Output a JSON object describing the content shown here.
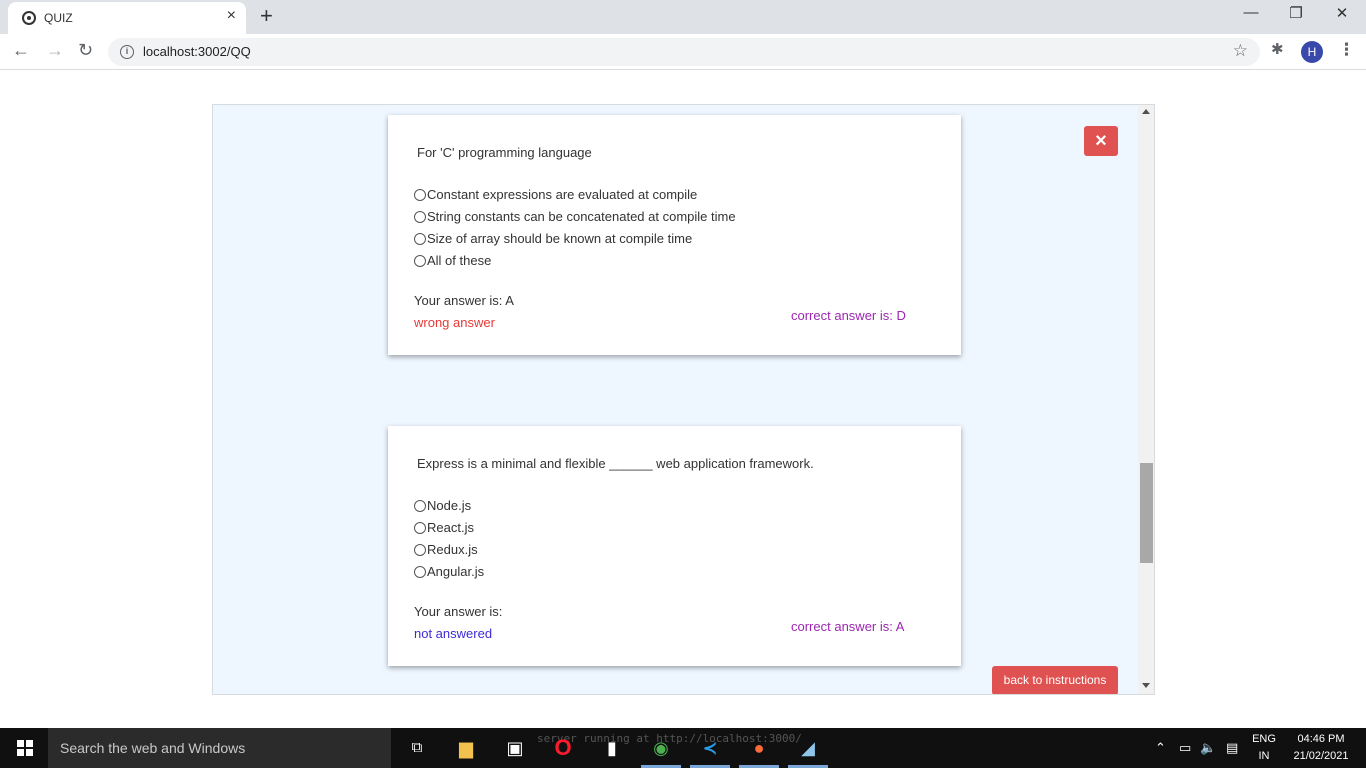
{
  "browser": {
    "tab_title": "QUIZ",
    "tab_close": "×",
    "new_tab": "+",
    "url": "localhost:3002/QQ",
    "avatar_letter": "H",
    "window": {
      "minimize": "—",
      "restore": "❐",
      "close": "✕"
    }
  },
  "quiz": {
    "close_label": "×",
    "back_label": "back to instructions",
    "questions": [
      {
        "text": "For 'C' programming language",
        "options": [
          "Constant expressions are evaluated at compile",
          "String constants can be concatenated at compile time",
          "Size of array should be known at compile time",
          "All of these"
        ],
        "your_answer": "Your answer is: A",
        "status": "wrong answer",
        "correct": "correct answer is: D"
      },
      {
        "text": "Express is a minimal and flexible ______ web application framework.",
        "options": [
          "Node.js",
          "React.js",
          "Redux.js",
          "Angular.js"
        ],
        "your_answer": "Your answer is:",
        "status": "not answered",
        "correct": "correct answer is: A"
      }
    ]
  },
  "taskbar": {
    "search_placeholder": "Search the web and Windows",
    "faint_text": "server running at http://localhost:3000/",
    "language": "ENG",
    "region": "IN",
    "time": "04:46 PM",
    "date": "21/02/2021"
  },
  "colors": {
    "wrong": "#e53935",
    "not_answered": "#3d2bd6",
    "correct": "#9c27b0",
    "button": "#e05252",
    "frame_bg": "#eef6ff"
  }
}
